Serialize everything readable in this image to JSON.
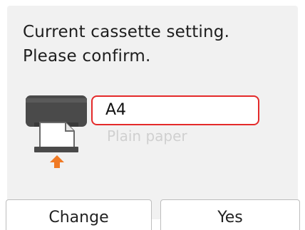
{
  "message": {
    "line1": "Current cassette setting.",
    "line2": "Please confirm."
  },
  "cassette": {
    "paper_size": "A4",
    "media_type": "Plain paper",
    "icon": "printer-cassette-icon",
    "arrow_icon": "up-arrow-icon"
  },
  "buttons": {
    "change_label": "Change",
    "yes_label": "Yes"
  },
  "colors": {
    "selection_border": "#e42a2a",
    "arrow": "#f07a25",
    "printer_body": "#4a4a4a"
  }
}
